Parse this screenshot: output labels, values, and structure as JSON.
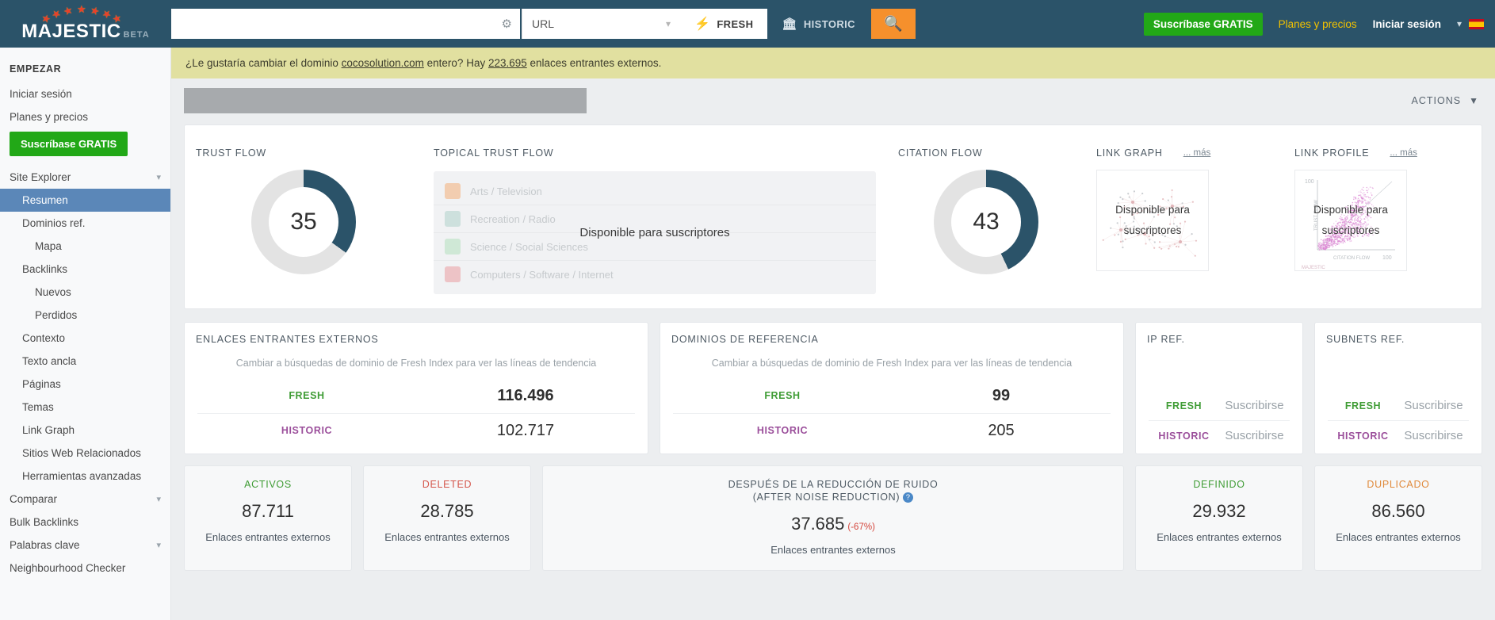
{
  "brand": {
    "name": "MAJESTIC",
    "beta": "BETA"
  },
  "search": {
    "value": "",
    "placeholder": "",
    "gear_icon": "gear-icon",
    "type_selected": "URL",
    "fresh_label": "FRESH",
    "historic_label": "HISTORIC",
    "search_icon": "search-icon"
  },
  "topnav": {
    "subscribe": "Suscríbase GRATIS",
    "plans": "Planes y precios",
    "signin": "Iniciar sesión",
    "lang_flag": "spain-flag-icon"
  },
  "sidebar": {
    "heading": "EMPEZAR",
    "signin": "Iniciar sesión",
    "plans": "Planes y precios",
    "subscribe": "Suscríbase GRATIS",
    "items": [
      {
        "label": "Site Explorer",
        "level": 0,
        "chevron": true,
        "selected": false
      },
      {
        "label": "Resumen",
        "level": 1,
        "chevron": false,
        "selected": true
      },
      {
        "label": "Dominios ref.",
        "level": 1,
        "chevron": false,
        "selected": false
      },
      {
        "label": "Mapa",
        "level": 2,
        "chevron": false,
        "selected": false
      },
      {
        "label": "Backlinks",
        "level": 1,
        "chevron": false,
        "selected": false
      },
      {
        "label": "Nuevos",
        "level": 2,
        "chevron": false,
        "selected": false
      },
      {
        "label": "Perdidos",
        "level": 2,
        "chevron": false,
        "selected": false
      },
      {
        "label": "Contexto",
        "level": 1,
        "chevron": false,
        "selected": false
      },
      {
        "label": "Texto ancla",
        "level": 1,
        "chevron": false,
        "selected": false
      },
      {
        "label": "Páginas",
        "level": 1,
        "chevron": false,
        "selected": false
      },
      {
        "label": "Temas",
        "level": 1,
        "chevron": false,
        "selected": false
      },
      {
        "label": "Link Graph",
        "level": 1,
        "chevron": false,
        "selected": false
      },
      {
        "label": "Sitios Web Relacionados",
        "level": 1,
        "chevron": false,
        "selected": false
      },
      {
        "label": "Herramientas avanzadas",
        "level": 1,
        "chevron": false,
        "selected": false
      },
      {
        "label": "Comparar",
        "level": 0,
        "chevron": true,
        "selected": false
      },
      {
        "label": "Bulk Backlinks",
        "level": 0,
        "chevron": false,
        "selected": false
      },
      {
        "label": "Palabras clave",
        "level": 0,
        "chevron": true,
        "selected": false
      },
      {
        "label": "Neighbourhood Checker",
        "level": 0,
        "chevron": false,
        "selected": false
      }
    ]
  },
  "notice": {
    "pre": "¿Le gustaría cambiar el dominio ",
    "domain": "cocosolution.com",
    "mid": " entero? Hay ",
    "count": "223.695",
    "post": " enlaces entrantes externos."
  },
  "actions": {
    "label": "ACTIONS",
    "chevron": "chevron-down-icon"
  },
  "chart_data": [
    {
      "type": "pie",
      "title": "TRUST FLOW",
      "value": 35,
      "max": 100,
      "filled_color": "#2b5369",
      "track_color": "#e3e3e3"
    },
    {
      "type": "pie",
      "title": "CITATION FLOW",
      "value": 43,
      "max": 100,
      "filled_color": "#2b5369",
      "track_color": "#e3e3e3"
    },
    {
      "type": "bar",
      "title": "TOPICAL TRUST FLOW",
      "locked_message": "Disponible para suscriptores",
      "categories": [
        "Arts / Television",
        "Recreation / Radio",
        "Science / Social Sciences",
        "Computers / Software / Internet"
      ],
      "values": [
        0,
        0,
        0,
        0
      ],
      "colors": [
        "#f2cdb0",
        "#cde0dd",
        "#cfe8d6",
        "#edc3c6"
      ]
    },
    {
      "type": "scatter",
      "title": "LINK GRAPH",
      "more_label": "... más",
      "locked_message": "Disponible para suscriptores"
    },
    {
      "type": "scatter",
      "title": "LINK PROFILE",
      "more_label": "... más",
      "locked_message": "Disponible para suscriptores",
      "xlabel": "CITATION FLOW",
      "ylabel": "TRUST FLOW",
      "xlim": [
        0,
        100
      ],
      "ylim": [
        0,
        100
      ],
      "watermark": "MAJESTIC"
    }
  ],
  "row2": {
    "external_backlinks": {
      "title": "ENLACES ENTRANTES EXTERNOS",
      "subtitle": "Cambiar a búsquedas de dominio de Fresh Index para ver las líneas de tendencia",
      "rows": [
        {
          "key": "FRESH",
          "value": "116.496"
        },
        {
          "key": "HISTORIC",
          "value": "102.717"
        }
      ]
    },
    "referring_domains": {
      "title": "DOMINIOS DE REFERENCIA",
      "subtitle": "Cambiar a búsquedas de dominio de Fresh Index para ver las líneas de tendencia",
      "rows": [
        {
          "key": "FRESH",
          "value": "99"
        },
        {
          "key": "HISTORIC",
          "value": "205"
        }
      ]
    },
    "ip_ref": {
      "title": "IP REF.",
      "rows": [
        {
          "key": "FRESH",
          "value": "Suscribirse"
        },
        {
          "key": "HISTORIC",
          "value": "Suscribirse"
        }
      ]
    },
    "subnets_ref": {
      "title": "SUBNETS REF.",
      "rows": [
        {
          "key": "FRESH",
          "value": "Suscribirse"
        },
        {
          "key": "HISTORIC",
          "value": "Suscribirse"
        }
      ]
    }
  },
  "row3": {
    "activos": {
      "title": "ACTIVOS",
      "number": "87.711",
      "sub": "Enlaces entrantes externos"
    },
    "deleted": {
      "title": "DELETED",
      "number": "28.785",
      "sub": "Enlaces entrantes externos"
    },
    "noise": {
      "title_l1": "DESPUÉS DE LA REDUCCIÓN DE RUIDO",
      "title_l2": "(AFTER NOISE REDUCTION)",
      "help": "?",
      "number": "37.685",
      "pct": "(-67%)",
      "sub": "Enlaces entrantes externos"
    },
    "definido": {
      "title": "DEFINIDO",
      "number": "29.932",
      "sub": "Enlaces entrantes externos"
    },
    "duplicado": {
      "title": "DUPLICADO",
      "number": "86.560",
      "sub": "Enlaces entrantes externos"
    }
  }
}
